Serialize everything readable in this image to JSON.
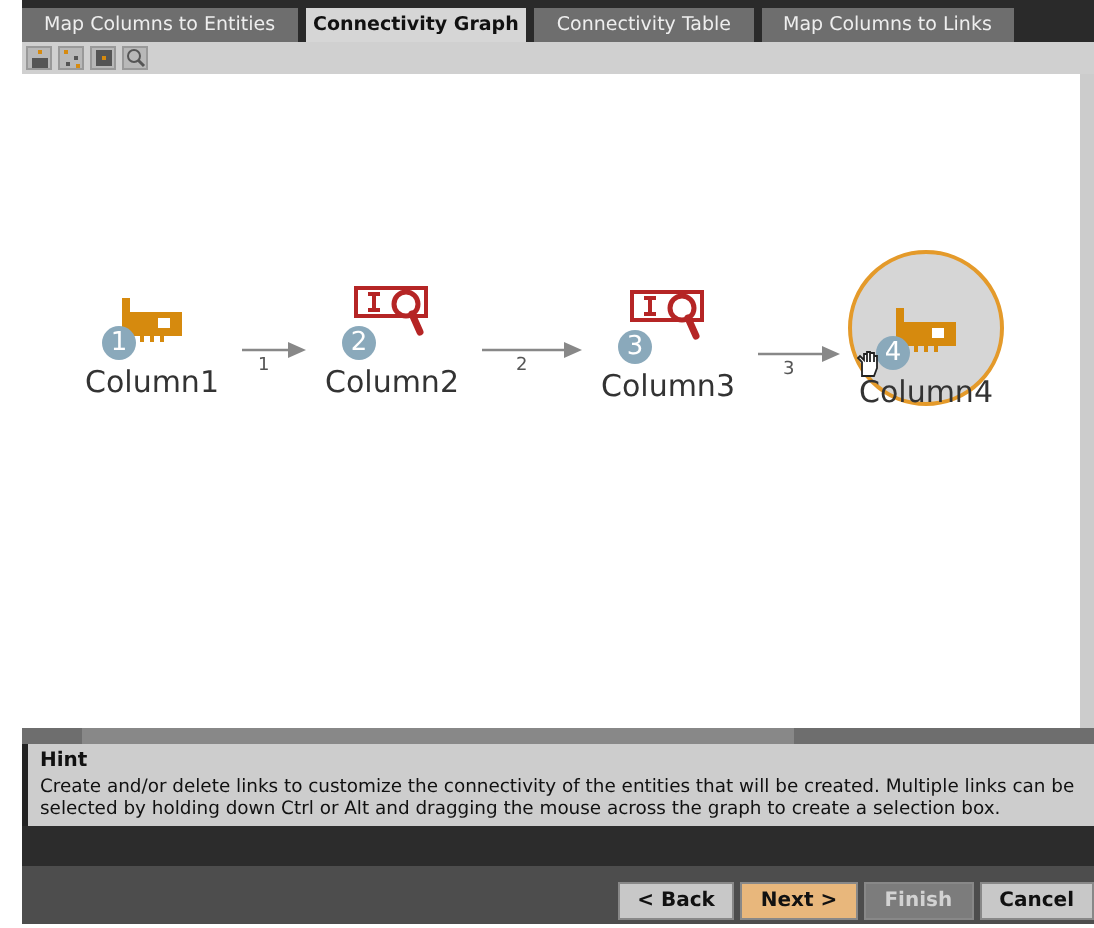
{
  "tabs": [
    {
      "label": "Map Columns to Entities",
      "selected": false
    },
    {
      "label": "Connectivity Graph",
      "selected": true
    },
    {
      "label": "Connectivity Table",
      "selected": false
    },
    {
      "label": "Map Columns to Links",
      "selected": false
    }
  ],
  "toolbar": [
    {
      "kind": "hierarchy"
    },
    {
      "kind": "organic"
    },
    {
      "kind": "grid"
    },
    {
      "kind": "zoom"
    }
  ],
  "graph": {
    "nodes": [
      {
        "number": "1",
        "label": "Column1",
        "kind": "card",
        "selected": false
      },
      {
        "number": "2",
        "label": "Column2",
        "kind": "search",
        "selected": false
      },
      {
        "number": "3",
        "label": "Column3",
        "kind": "search",
        "selected": false
      },
      {
        "number": "4",
        "label": "Column4",
        "kind": "card",
        "selected": true
      }
    ],
    "edges": [
      {
        "label": "1"
      },
      {
        "label": "2"
      },
      {
        "label": "3"
      }
    ]
  },
  "hint": {
    "title": "Hint",
    "text": "Create and/or delete links to customize the connectivity of the entities that will be created. Multiple links can be selected by holding down Ctrl or Alt and dragging the mouse across the graph to create a selection box."
  },
  "buttons": [
    {
      "label": "< Back",
      "kind": "normal",
      "disabled": false
    },
    {
      "label": "Next >",
      "kind": "primary",
      "disabled": false
    },
    {
      "label": "Finish",
      "kind": "normal",
      "disabled": true
    },
    {
      "label": "Cancel",
      "kind": "normal",
      "disabled": false
    }
  ]
}
